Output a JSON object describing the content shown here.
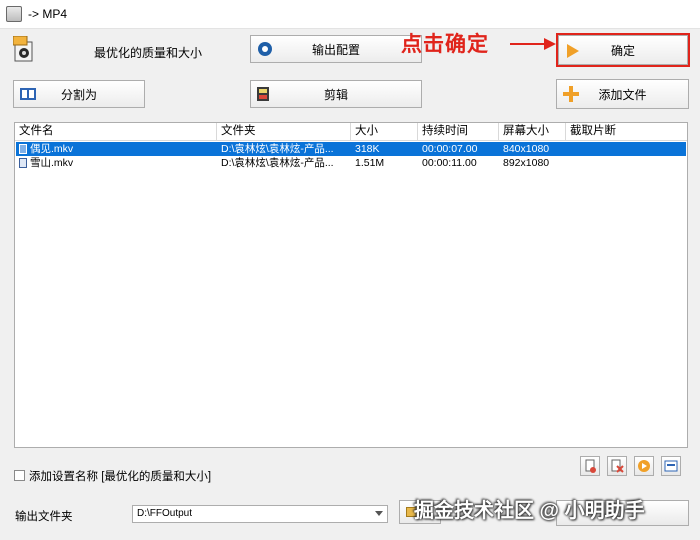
{
  "window": {
    "title": "-> MP4"
  },
  "profile": {
    "label": "最优化的质量和大小"
  },
  "buttons": {
    "output_config": "输出配置",
    "ok": "确定",
    "split": "分割为",
    "clip": "剪辑",
    "add_file": "添加文件"
  },
  "annotation": {
    "text": "点击确定",
    "color": "#e0241b"
  },
  "list": {
    "columns": [
      "文件名",
      "文件夹",
      "大小",
      "持续时间",
      "屏幕大小",
      "截取片断"
    ],
    "rows": [
      {
        "name": "偶见.mkv",
        "folder": "D:\\袁林炫\\袁林炫-产品...",
        "size": "318K",
        "duration": "00:00:07.00",
        "resolution": "840x1080",
        "clip": "",
        "selected": true
      },
      {
        "name": "雪山.mkv",
        "folder": "D:\\袁林炫\\袁林炫-产品...",
        "size": "1.51M",
        "duration": "00:00:11.00",
        "resolution": "892x1080",
        "clip": "",
        "selected": false
      }
    ]
  },
  "options": {
    "add_setting_name": "添加设置名称 [最优化的质量和大小]"
  },
  "output": {
    "label": "输出文件夹",
    "path": "D:\\FFOutput"
  },
  "watermark": "掘金技术社区 @ 小明助手",
  "colors": {
    "selection": "#0a73d8",
    "annotation": "#e0241b"
  }
}
